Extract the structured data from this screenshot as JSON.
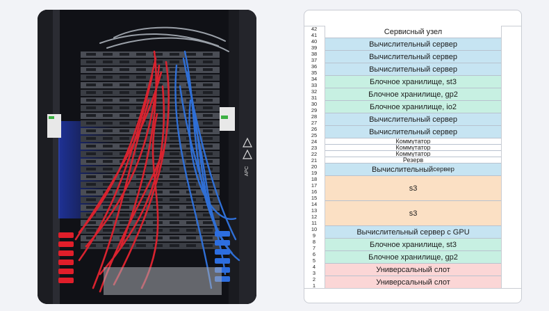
{
  "photo": {
    "logo": "APC"
  },
  "rack": {
    "units": [
      "42",
      "41",
      "40",
      "39",
      "38",
      "37",
      "36",
      "35",
      "34",
      "33",
      "32",
      "31",
      "30",
      "29",
      "28",
      "27",
      "26",
      "25",
      "24",
      "23",
      "22",
      "21",
      "20",
      "19",
      "18",
      "17",
      "16",
      "15",
      "14",
      "13",
      "12",
      "11",
      "10",
      "9",
      "8",
      "7",
      "6",
      "5",
      "4",
      "3",
      "2",
      "1"
    ],
    "slots": [
      {
        "label": "Сервисный узел",
        "top_unit": 42,
        "height_u": 2,
        "color": "#ffffff"
      },
      {
        "label": "Вычислительный сервер",
        "top_unit": 40,
        "height_u": 2,
        "color": "#c6e4f2"
      },
      {
        "label": "Вычислительный сервер",
        "top_unit": 38,
        "height_u": 2,
        "color": "#c6e4f2"
      },
      {
        "label": "Вычислительный сервер",
        "top_unit": 36,
        "height_u": 2,
        "color": "#c6e4f2"
      },
      {
        "label": "Блочное хранилище, st3",
        "top_unit": 34,
        "height_u": 2,
        "color": "#c7f0e2"
      },
      {
        "label": "Блочное хранилище, gp2",
        "top_unit": 32,
        "height_u": 2,
        "color": "#c7f0e2"
      },
      {
        "label": "Блочное хранилище, io2",
        "top_unit": 30,
        "height_u": 2,
        "color": "#c7f0e2"
      },
      {
        "label": "Вычислительный сервер",
        "top_unit": 28,
        "height_u": 2,
        "color": "#c6e4f2"
      },
      {
        "label": "Вычислительный сервер",
        "top_unit": 26,
        "height_u": 2,
        "color": "#c6e4f2"
      },
      {
        "label": "Коммутатор",
        "top_unit": 24,
        "height_u": 1,
        "color": "#ffffff",
        "small": true
      },
      {
        "label": "Коммутатор",
        "top_unit": 23,
        "height_u": 1,
        "color": "#ffffff",
        "small": true
      },
      {
        "label": "Коммутатор",
        "top_unit": 22,
        "height_u": 1,
        "color": "#ffffff",
        "small": true
      },
      {
        "label": "Резерв",
        "top_unit": 21,
        "height_u": 1,
        "color": "#ffffff",
        "small": true
      },
      {
        "label": "Вычислительный",
        "sub": " сервер",
        "top_unit": 20,
        "height_u": 2,
        "color": "#c6e4f2"
      },
      {
        "label": "s3",
        "top_unit": 18,
        "height_u": 4,
        "color": "#fbe0c4"
      },
      {
        "label": "s3",
        "top_unit": 14,
        "height_u": 4,
        "color": "#fbe0c4"
      },
      {
        "label": "Вычислительный сервер с GPU",
        "top_unit": 10,
        "height_u": 2,
        "color": "#c6e4f2"
      },
      {
        "label": "Блочное хранилище, st3",
        "top_unit": 8,
        "height_u": 2,
        "color": "#c7f0e2"
      },
      {
        "label": "Блочное хранилище, gp2",
        "top_unit": 6,
        "height_u": 2,
        "color": "#c7f0e2"
      },
      {
        "label": "Универсальный слот",
        "top_unit": 4,
        "height_u": 2,
        "color": "#fbd6d6"
      },
      {
        "label": "Универсальный слот",
        "top_unit": 2,
        "height_u": 2,
        "color": "#fbd6d6"
      }
    ]
  }
}
